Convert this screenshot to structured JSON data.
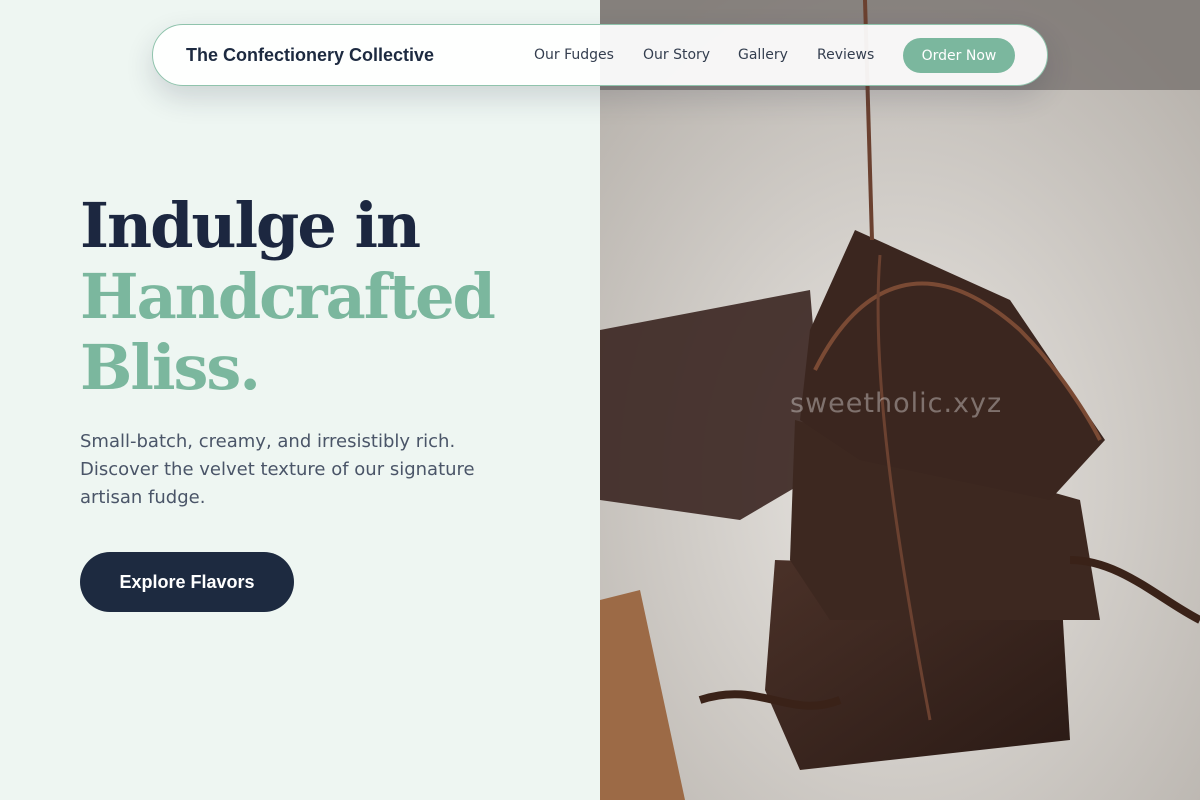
{
  "nav": {
    "brand": "The Confectionery Collective",
    "links": [
      "Our Fudges",
      "Our Story",
      "Gallery",
      "Reviews"
    ],
    "cta": "Order Now"
  },
  "hero": {
    "title_line1": "Indulge in",
    "title_line2": "Handcrafted",
    "title_line3": "Bliss.",
    "subtitle": "Small-batch, creamy, and irresistibly rich. Discover the velvet texture of our signature artisan fudge.",
    "cta": "Explore Flavors"
  },
  "image": {
    "subject": "stacked chocolate brownies with chocolate drizzle",
    "watermark": "sweetholic.xyz"
  },
  "colors": {
    "background": "#eef6f2",
    "navy": "#1d2a40",
    "sage": "#7bb79e",
    "body_text": "#4a5568"
  }
}
